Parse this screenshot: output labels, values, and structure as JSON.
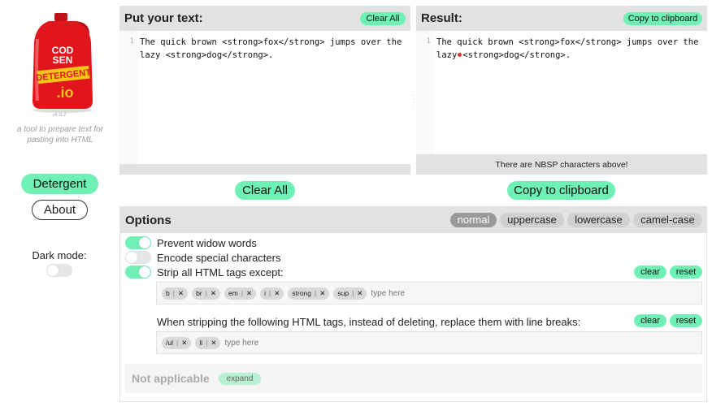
{
  "sidebar": {
    "logo": {
      "line1": "COD",
      "line2": "SEN",
      "line3": "DETERGENT",
      "line4": ".io"
    },
    "version": "v4.11.2",
    "tagline": "a tool to prepare text for pasting into HTML",
    "detergent_label": "Detergent",
    "about_label": "About",
    "dark_mode_label": "Dark mode:",
    "dark_mode_on": false
  },
  "input_panel": {
    "title": "Put your text:",
    "clear_label": "Clear All",
    "line_number": "1",
    "line1": "The quick brown <strong>fox</strong> jumps over the",
    "line2": "lazy <strong>dog</strong>."
  },
  "result_panel": {
    "title": "Result:",
    "copy_label": "Copy to clipboard",
    "line_number": "1",
    "line1": "The quick brown <strong>fox</strong> jumps over the",
    "line2_pre": "lazy",
    "line2_post": "<strong>dog</strong>.",
    "nbsp_note": "There are NBSP characters above!"
  },
  "actions": {
    "clear_all_label": "Clear All",
    "copy_label": "Copy to clipboard"
  },
  "options": {
    "title": "Options",
    "case_modes": [
      {
        "label": "normal",
        "active": true
      },
      {
        "label": "uppercase",
        "active": false
      },
      {
        "label": "lowercase",
        "active": false
      },
      {
        "label": "camel-case",
        "active": false
      }
    ],
    "prevent_widow_label": "Prevent widow words",
    "prevent_widow_on": true,
    "encode_special_label": "Encode special characters",
    "encode_special_on": false,
    "strip_html_label": "Strip all HTML tags except:",
    "strip_html_on": true,
    "strip_clear": "clear",
    "strip_reset": "reset",
    "keep_tags": [
      "b",
      "br",
      "em",
      "i",
      "strong",
      "sup"
    ],
    "tag_remove_glyph": "✕",
    "tag_placeholder": "type here",
    "replace_label": "When stripping the following HTML tags, instead of deleting, replace them with line breaks:",
    "replace_clear": "clear",
    "replace_reset": "reset",
    "replace_tags": [
      "/ul",
      "li"
    ],
    "not_applicable_label": "Not applicable",
    "expand_label": "expand"
  },
  "colors": {
    "accent": "#6ff0b4",
    "panel_bg": "#e2e2e2",
    "nbsp_marker": "#e0332c"
  }
}
